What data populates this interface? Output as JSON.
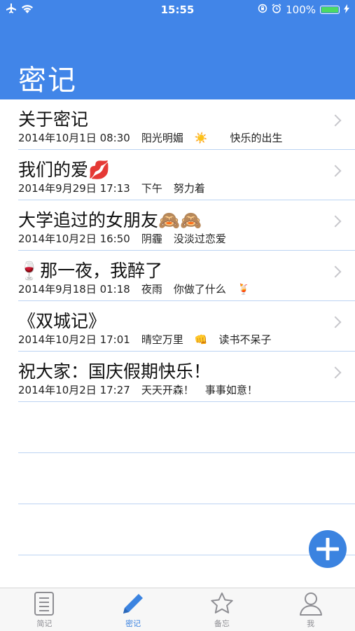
{
  "status_bar": {
    "time": "15:55",
    "battery": "100%",
    "battery_level": 1.0
  },
  "header": {
    "title": "密记"
  },
  "entries": [
    {
      "title": "关于密记",
      "date": "2014年10月1日 08:30",
      "weather": "阳光明媚",
      "weather_icon": "sun-emoji",
      "mood": "快乐的出生"
    },
    {
      "title": "我们的爱",
      "title_icon": "kiss-emoji",
      "date": "2014年9月29日 17:13",
      "weather": "下午",
      "mood": "努力着"
    },
    {
      "title": "大学追过的女朋友",
      "title_icon": "see-no-evil-monkey-emoji",
      "date": "2014年10月2日 16:50",
      "weather": "阴霾",
      "mood": "没淡过恋爱"
    },
    {
      "title": "那一夜，我醉了",
      "title_icon": "wine-glass-emoji",
      "date": "2014年9月18日 01:18",
      "weather": "夜雨",
      "mood": "你做了什么",
      "mood_icon": "cocktail-emoji"
    },
    {
      "title": "《双城记》",
      "date": "2014年10月2日 17:01",
      "weather": "晴空万里",
      "mood": "读书不呆子",
      "mood_icon": "fist-emoji"
    },
    {
      "title": "祝大家：国庆假期快乐！",
      "date": "2014年10月2日 17:27",
      "weather": "天天开森！",
      "mood": "事事如意！"
    }
  ],
  "tabs": [
    {
      "label": "简记",
      "icon": "notepad-icon",
      "active": false
    },
    {
      "label": "密记",
      "icon": "pencil-icon",
      "active": true
    },
    {
      "label": "备忘",
      "icon": "star-icon",
      "active": false
    },
    {
      "label": "我",
      "icon": "person-icon",
      "active": false
    }
  ],
  "colors": {
    "accent": "#4185e8",
    "active_tab": "#3b83e0",
    "inactive_tab": "#8e8e93",
    "separator": "#bcd3f2"
  }
}
